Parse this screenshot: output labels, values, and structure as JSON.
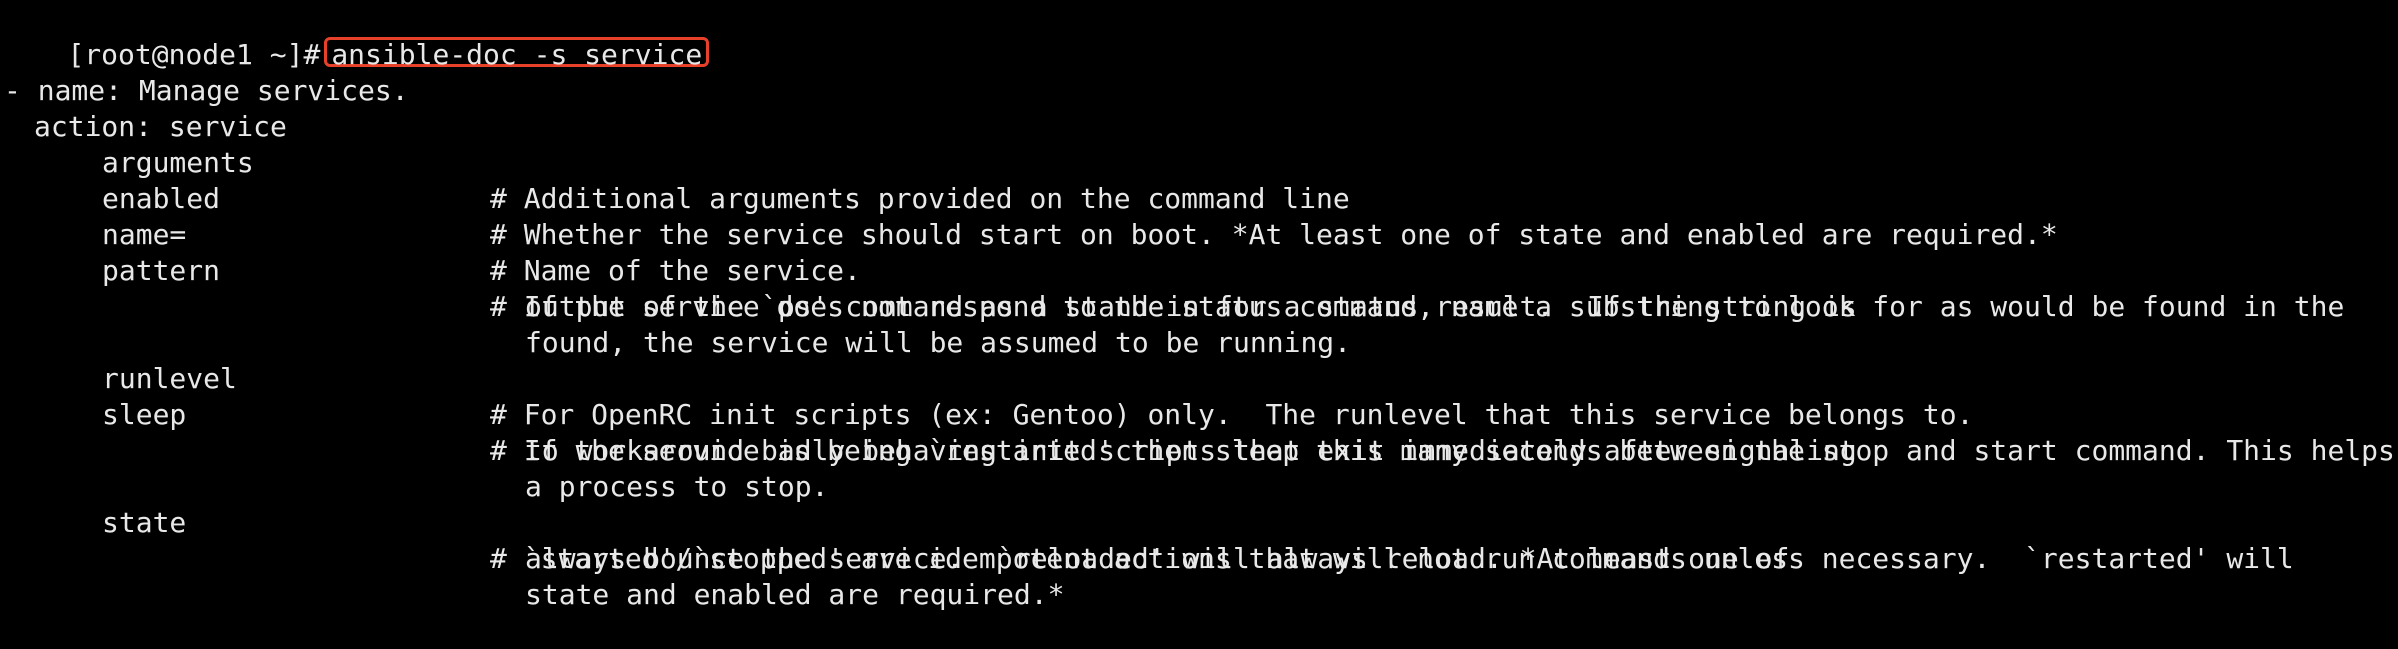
{
  "terminal": {
    "prompt": "[root@node1 ~]#",
    "command": "ansible-doc -s service",
    "header_lines": [
      "- name: Manage services.",
      "action: service"
    ],
    "options": [
      {
        "key": "arguments",
        "desc": "# Additional arguments provided on the command line",
        "cont": []
      },
      {
        "key": "enabled",
        "desc": "# Whether the service should start on boot. *At least one of state and enabled are required.*",
        "cont": []
      },
      {
        "key": "name=",
        "desc": "# Name of the service.",
        "cont": []
      },
      {
        "key": "pattern",
        "desc": "# If the service does not respond to the status command, name a substring to look for as would be found in the",
        "cont": [
          "output of the `ps' command as a stand-in for a status result.  If the string is",
          "found, the service will be assumed to be running."
        ]
      },
      {
        "key": "runlevel",
        "desc": "# For OpenRC init scripts (ex: Gentoo) only.  The runlevel that this service belongs to.",
        "cont": []
      },
      {
        "key": "sleep",
        "desc": "# If the service is being `restarted' then sleep this many seconds between the stop and start command. This helps",
        "cont": [
          "to workaround badly behaving init scripts that exit immediately after signaling",
          "a process to stop."
        ]
      },
      {
        "key": "state",
        "desc": "# `started'/`stopped' are idempotent actions that will not run commands unless necessary.  `restarted' will",
        "cont": [
          "always bounce the service.  `reloaded' will always reload. *At least one of",
          "state and enabled are required.*"
        ]
      }
    ],
    "highlight_color": "#e8412a",
    "background_color": "#000000",
    "text_color": "#e8e8e8"
  }
}
